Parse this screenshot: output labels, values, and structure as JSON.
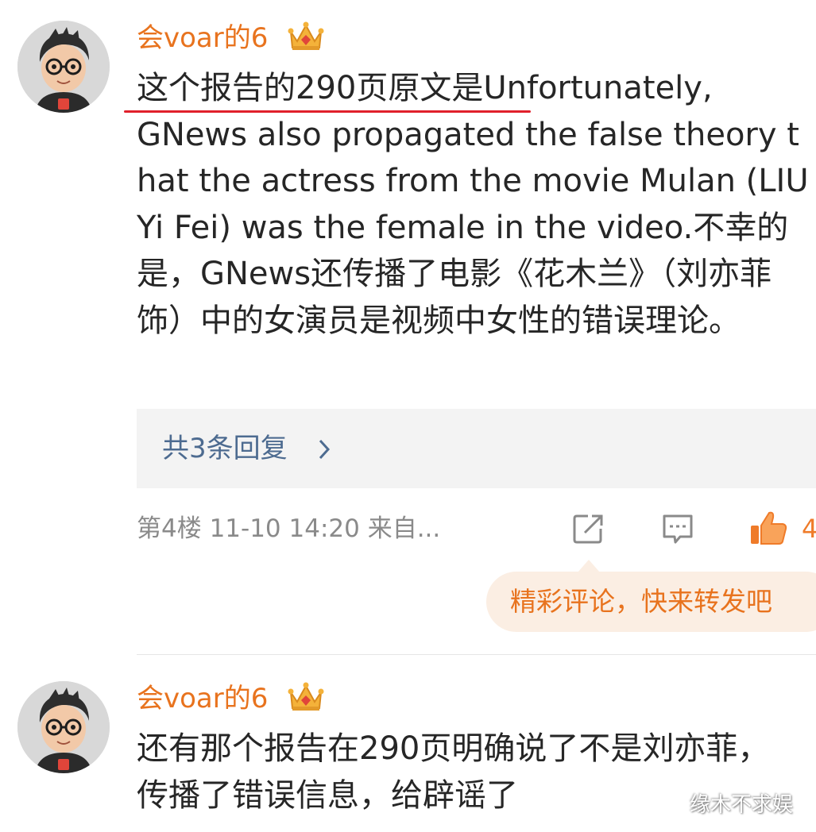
{
  "comments": [
    {
      "username": "会voar的6",
      "line1_highlight": "这个报告的290页原文是",
      "line1_rest": "Unfortunately,",
      "body_rest": "GNews also propagated the false theory that the actress from the movie Mulan (LIU Yi Fei) was the female in the video.不幸的是，GNews还传播了电影《花木兰》（刘亦菲饰）中的女演员是视频中女性的错误理论。",
      "replies_label": "共3条回复",
      "meta": "第4楼  11-10 14:20  来自...",
      "likes": "4"
    },
    {
      "username": "会voar的6",
      "body": "还有那个报告在290页明确说了不是刘亦菲，传播了错误信息，给辟谣了"
    }
  ],
  "tooltip": "精彩评论，快来转发吧",
  "watermark": "缘木不求娱",
  "icons": {
    "crown": "crown-icon",
    "chevron": "chevron-right-icon",
    "share": "share-icon",
    "comment": "comment-icon",
    "like": "like-icon"
  },
  "colors": {
    "username": "#e8731e",
    "text": "#262626",
    "link": "#4d6b90",
    "meta": "#8a8a8a",
    "like": "#ef7b29",
    "underline": "#e0202b",
    "tooltip_bg": "#fbeee3"
  }
}
